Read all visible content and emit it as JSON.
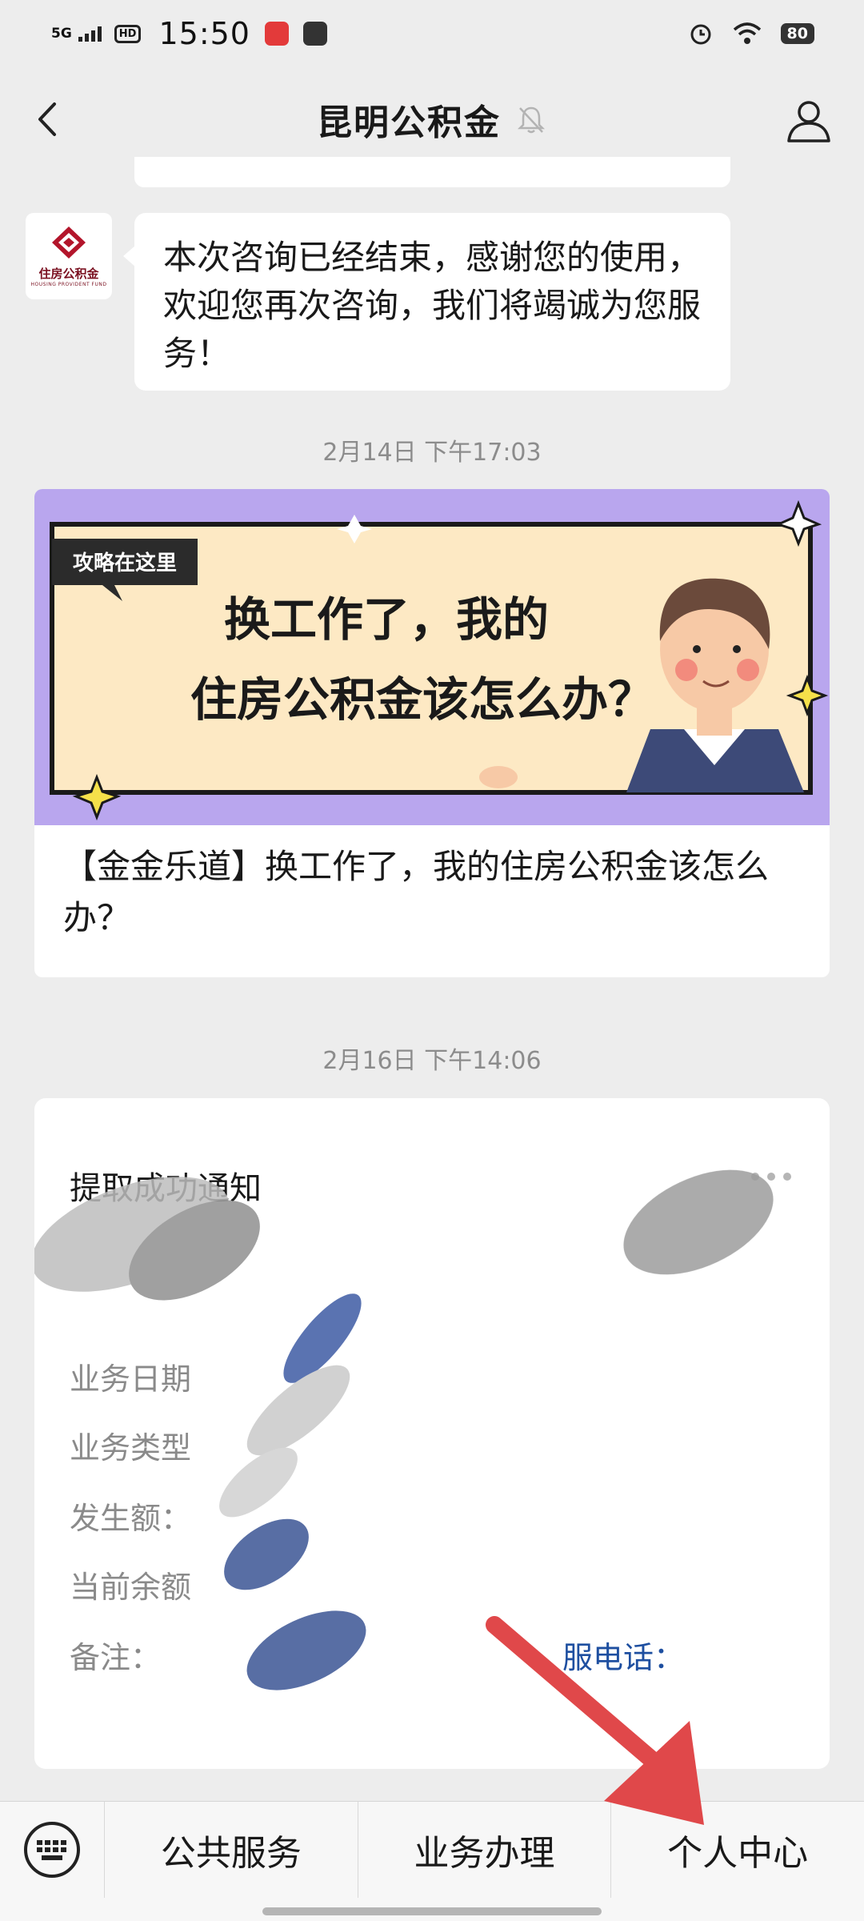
{
  "status_bar": {
    "network": "5G",
    "hd": "HD",
    "time": "15:50",
    "battery": "80",
    "icons": [
      "signal-icon",
      "alarm-icon",
      "wifi-icon",
      "battery-icon"
    ]
  },
  "header": {
    "title": "昆明公积金",
    "icons": [
      "back-icon",
      "mute-bell-icon",
      "profile-icon"
    ]
  },
  "chat": {
    "avatar_label": "住房公积金",
    "avatar_sub": "HOUSING PROVIDENT FUND",
    "bot_message": "本次咨询已经结束，感谢您的使用，欢迎您再次咨询，我们将竭诚为您服务！",
    "timestamp_1": "2月14日 下午17:03",
    "timestamp_2": "2月16日 下午14:06"
  },
  "article": {
    "banner_tag": "攻略在这里",
    "banner_line1": "换工作了，我的",
    "banner_line2": "住房公积金该怎么办？",
    "title": "【金金乐道】换工作了，我的住房公积金该怎么办？"
  },
  "notice": {
    "title": "提取成功通知",
    "rows": [
      {
        "label": "业务日期"
      },
      {
        "label": "业务类型"
      },
      {
        "label": "发生额："
      },
      {
        "label": "当前余额"
      },
      {
        "label": "备注："
      }
    ],
    "hotline": "服电话："
  },
  "bottom_menu": {
    "items": [
      "公共服务",
      "业务办理",
      "个人中心"
    ]
  },
  "colors": {
    "background": "#ededed",
    "bubble": "#ffffff",
    "banner_purple": "#b9a6ee",
    "banner_cream": "#fde9c4",
    "arrow_red": "#e0484a",
    "link_blue": "#1e4fa0"
  }
}
